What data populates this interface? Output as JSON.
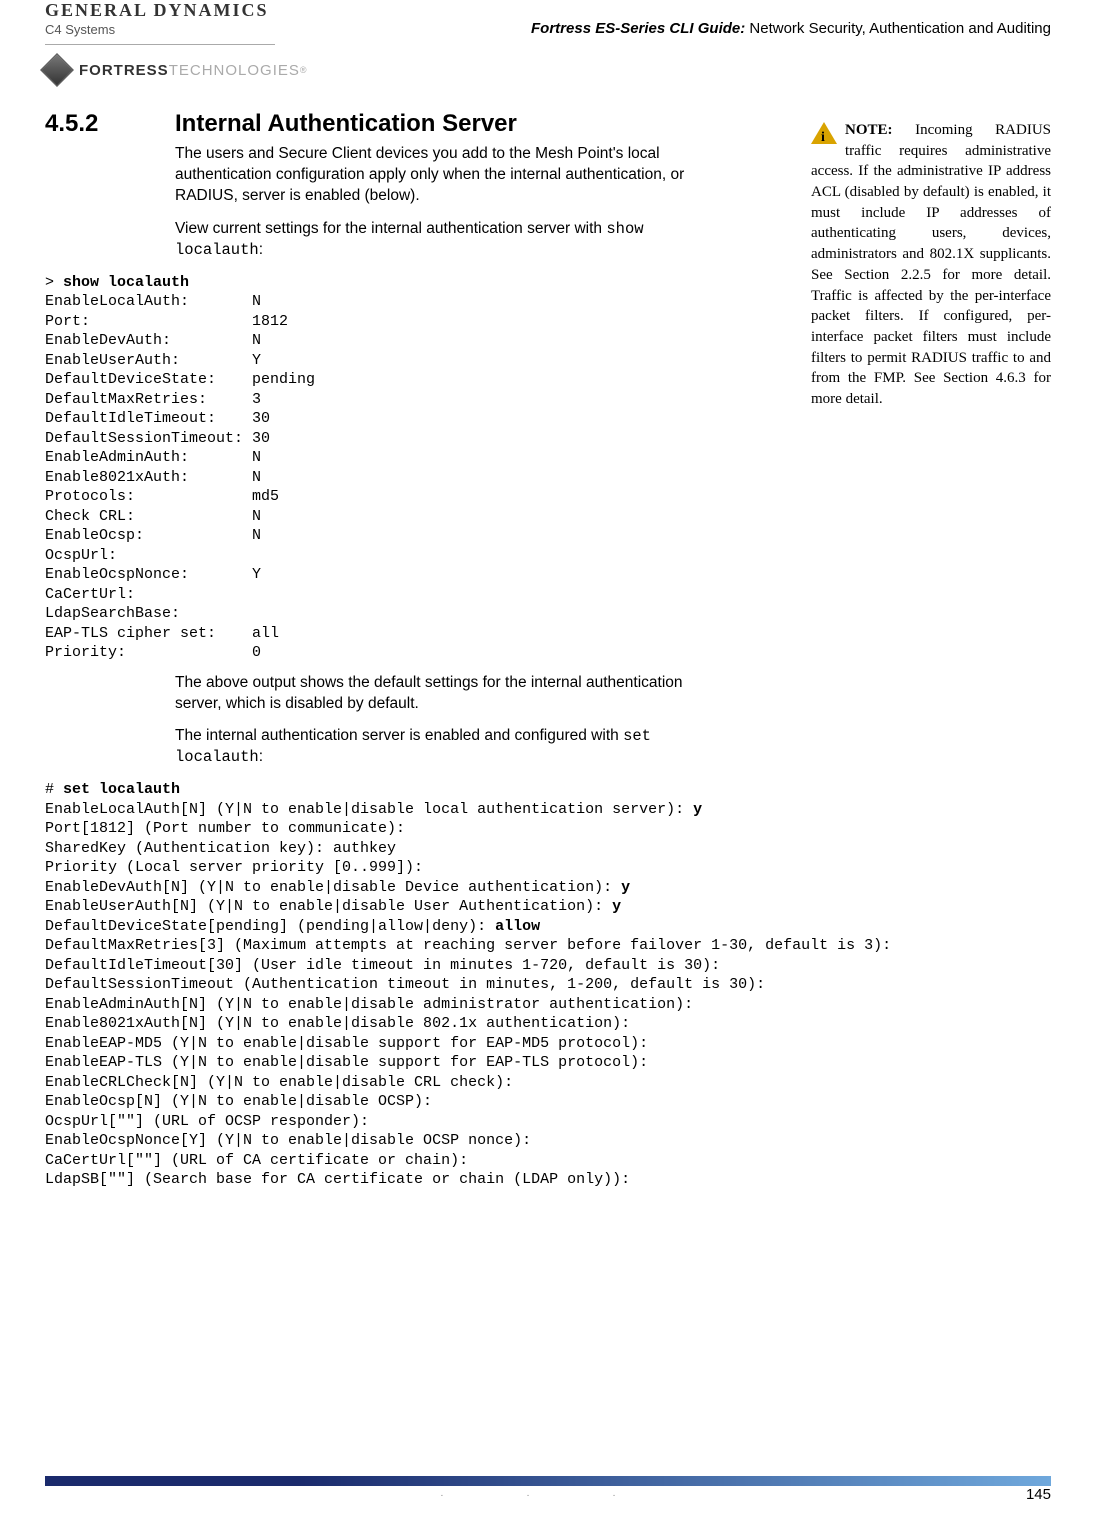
{
  "header": {
    "gd_logo_top": "GENERAL DYNAMICS",
    "gd_logo_sub": "C4 Systems",
    "fortress_bold": "FORTRESS",
    "fortress_light": "TECHNOLOGIES",
    "fortress_reg": "®",
    "guide_bold": "Fortress ES-Series CLI Guide:",
    "guide_rest": " Network Security, Authentication and Auditing"
  },
  "section": {
    "number": "4.5.2",
    "title": "Internal Authentication Server",
    "para1": "The users and Secure Client devices you add to the Mesh Point's local authentication configuration apply only when the internal authentication, or RADIUS, server is enabled (below).",
    "para2_a": "View current settings for the internal authentication server with ",
    "para2_mono": "show localauth",
    "para2_b": ":",
    "para3": "The above output shows the default settings for the internal authentication server, which is disabled by default.",
    "para4_a": "The internal authentication server is enabled and configured with ",
    "para4_mono": "set localauth",
    "para4_b": ":"
  },
  "side_note": {
    "label": "NOTE:",
    "text": " Incoming RADIUS traffic requires administrative access. If the administrative IP address ACL (disabled by default) is enabled, it must include IP addresses of authenticating users, devices, administrators and 802.1X supplicants. See Section 2.2.5 for more detail. Traffic is affected by the per-interface packet filters. If configured, per-interface packet filters must include filters to permit RADIUS traffic to and from the FMP. See Section 4.6.3 for more detail."
  },
  "code1": {
    "prompt": "> ",
    "cmd": "show localauth",
    "lines": [
      "EnableLocalAuth:       N",
      "Port:                  1812",
      "EnableDevAuth:         N",
      "EnableUserAuth:        Y",
      "DefaultDeviceState:    pending",
      "DefaultMaxRetries:     3",
      "DefaultIdleTimeout:    30",
      "DefaultSessionTimeout: 30",
      "EnableAdminAuth:       N",
      "Enable8021xAuth:       N",
      "Protocols:             md5",
      "Check CRL:             N",
      "EnableOcsp:            N",
      "OcspUrl:",
      "EnableOcspNonce:       Y",
      "CaCertUrl:",
      "LdapSearchBase:",
      "EAP-TLS cipher set:    all",
      "Priority:              0"
    ]
  },
  "code2": {
    "prompt": "# ",
    "cmd": "set localauth",
    "lines": [
      {
        "t": "EnableLocalAuth[N] (Y|N to enable|disable local authentication server): ",
        "b": "y"
      },
      {
        "t": "Port[1812] (Port number to communicate):",
        "b": ""
      },
      {
        "t": "SharedKey (Authentication key): authkey",
        "b": ""
      },
      {
        "t": "Priority (Local server priority [0..999]):",
        "b": ""
      },
      {
        "t": "EnableDevAuth[N] (Y|N to enable|disable Device authentication): ",
        "b": "y"
      },
      {
        "t": "EnableUserAuth[N] (Y|N to enable|disable User Authentication): ",
        "b": "y"
      },
      {
        "t": "DefaultDeviceState[pending] (pending|allow|deny): ",
        "b": "allow"
      },
      {
        "t": "DefaultMaxRetries[3] (Maximum attempts at reaching server before failover 1-30, default is 3):",
        "b": ""
      },
      {
        "t": "DefaultIdleTimeout[30] (User idle timeout in minutes 1-720, default is 30):",
        "b": ""
      },
      {
        "t": "DefaultSessionTimeout (Authentication timeout in minutes, 1-200, default is 30):",
        "b": ""
      },
      {
        "t": "EnableAdminAuth[N] (Y|N to enable|disable administrator authentication):",
        "b": ""
      },
      {
        "t": "Enable8021xAuth[N] (Y|N to enable|disable 802.1x authentication):",
        "b": ""
      },
      {
        "t": "EnableEAP-MD5 (Y|N to enable|disable support for EAP-MD5 protocol):",
        "b": ""
      },
      {
        "t": "EnableEAP-TLS (Y|N to enable|disable support for EAP-TLS protocol):",
        "b": ""
      },
      {
        "t": "EnableCRLCheck[N] (Y|N to enable|disable CRL check):",
        "b": ""
      },
      {
        "t": "EnableOcsp[N] (Y|N to enable|disable OCSP):",
        "b": ""
      },
      {
        "t": "OcspUrl[\"\"] (URL of OCSP responder):",
        "b": ""
      },
      {
        "t": "EnableOcspNonce[Y] (Y|N to enable|disable OCSP nonce):",
        "b": ""
      },
      {
        "t": "CaCertUrl[\"\"] (URL of CA certificate or chain):",
        "b": ""
      },
      {
        "t": "LdapSB[\"\"] (Search base for CA certificate or chain (LDAP only)):",
        "b": ""
      }
    ]
  },
  "footer": {
    "page": "145"
  }
}
